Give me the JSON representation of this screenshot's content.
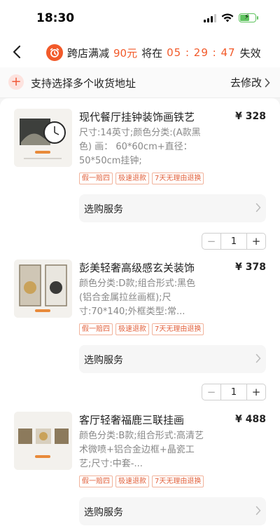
{
  "status": {
    "time": "18:30"
  },
  "nav": {
    "promo_prefix": "跨店满减",
    "promo_amount": "90元",
    "promo_mid": "将在",
    "countdown": "05 : 29 : 47",
    "promo_suffix": "失效"
  },
  "address": {
    "text": "支持选择多个收货地址",
    "action": "去修改"
  },
  "items": [
    {
      "title": "现代餐厅挂钟装饰画铁艺",
      "price": "¥ 328",
      "spec": "尺寸:14英寸;颜色分类:(A款黑色) 画： 60*60cm+直径： 50*50cm挂钟;",
      "tags": [
        "假一赔四",
        "极速退款",
        "7天无理由退换"
      ],
      "service_label": "选购服务",
      "quantity": "1"
    },
    {
      "title": "彭美轻奢高级感玄关装饰",
      "price": "¥ 378",
      "spec": "颜色分类:D款;组合形式:黑色 (铝合金属拉丝画框);尺寸:70*140;外框类型:常...",
      "tags": [
        "假一赔四",
        "极速退款",
        "7天无理由退换"
      ],
      "service_label": "选购服务",
      "quantity": "1"
    },
    {
      "title": "客厅轻奢福鹿三联挂画",
      "price": "¥ 488",
      "spec": "颜色分类:B款;组合形式:高清艺术微喷+铝合金边框+晶瓷工艺;尺寸:中套-...",
      "tags": [
        "假一赔四",
        "极速退款",
        "7天无理由退换"
      ],
      "service_label": "选购服务"
    }
  ],
  "colors": {
    "accent": "#f25a2a",
    "tag_text": "#e2613c",
    "tag_border": "#f1b39c"
  }
}
